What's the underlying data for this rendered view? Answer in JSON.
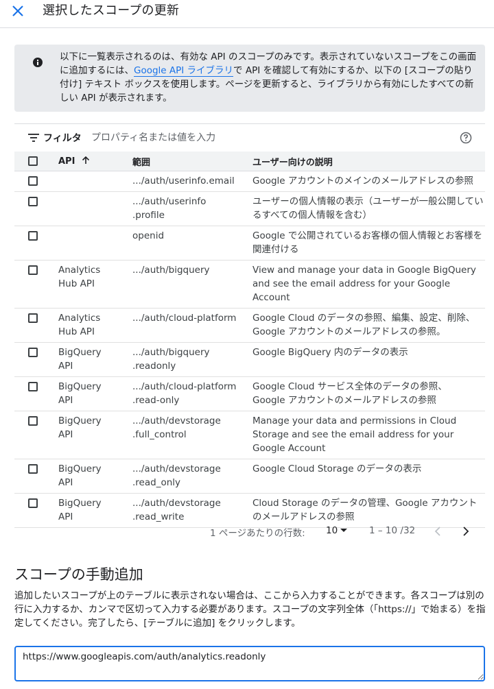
{
  "header": {
    "title": "選択したスコープの更新"
  },
  "info": {
    "text_before": "以下に一覧表示されるのは、有効な API のスコープのみです。表示されていないスコープをこの画面に追加するには、",
    "link": "Google API ライブラリ",
    "text_after": "で API を確認して有効にするか、以下の [スコープの貼り付け] テキスト ボックスを使用します。ページを更新すると、ライブラリから有効にしたすべての新しい API が表示されます。"
  },
  "filter": {
    "label": "フィルタ",
    "placeholder": "プロパティ名または値を入力"
  },
  "table": {
    "headers": {
      "api": "API",
      "scope": "範囲",
      "desc": "ユーザー向けの説明"
    },
    "rows": [
      {
        "api": "",
        "scope": ".../auth/userinfo.email",
        "desc": "Google アカウントのメインのメールアドレスの参照"
      },
      {
        "api": "",
        "scope": ".../auth/userinfo\n.profile",
        "desc": "ユーザーの個人情報の表示（ユーザーが一般公開しているすべての個人情報を含む）"
      },
      {
        "api": "",
        "scope": "openid",
        "desc": "Google で公開されているお客様の個人情報とお客様を関連付ける"
      },
      {
        "api": "Analytics\nHub API",
        "scope": ".../auth/bigquery",
        "desc": "View and manage your data in Google BigQuery and see the email address for your Google Account"
      },
      {
        "api": "Analytics\nHub API",
        "scope": ".../auth/cloud-platform",
        "desc": "Google Cloud のデータの参照、編集、設定、削除、Google アカウントのメールアドレスの参照。"
      },
      {
        "api": "BigQuery\nAPI",
        "scope": ".../auth/bigquery\n.readonly",
        "desc": "Google BigQuery 内のデータの表示"
      },
      {
        "api": "BigQuery\nAPI",
        "scope": ".../auth/cloud-platform\n.read-only",
        "desc": "Google Cloud サービス全体のデータの参照、\nGoogle アカウントのメールアドレスの参照"
      },
      {
        "api": "BigQuery\nAPI",
        "scope": ".../auth/devstorage\n.full_control",
        "desc": "Manage your data and permissions in Cloud Storage and see the email address for your Google Account"
      },
      {
        "api": "BigQuery\nAPI",
        "scope": ".../auth/devstorage\n.read_only",
        "desc": "Google Cloud Storage のデータの表示"
      },
      {
        "api": "BigQuery\nAPI",
        "scope": ".../auth/devstorage\n.read_write",
        "desc": "Cloud Storage のデータの管理、Google アカウントのメールアドレスの参照"
      }
    ]
  },
  "pager": {
    "rows_label": "1 ページあたりの行数:",
    "rows_value": "10",
    "range": "1 – 10 /32"
  },
  "manual": {
    "title": "スコープの手動追加",
    "description": "追加したいスコープが上のテーブルに表示されない場合は、ここから入力することができます。各スコープは別の行に入力するか、カンマで区切って入力する必要があります。スコープの文字列全体（「https://」で始まる）を指定してください。完了したら、[テーブルに追加] をクリックします。",
    "input_value": "https://www.googleapis.com/auth/analytics.readonly"
  },
  "colors": {
    "accent": "#1a73e8",
    "info_bg": "#e8eaed"
  }
}
